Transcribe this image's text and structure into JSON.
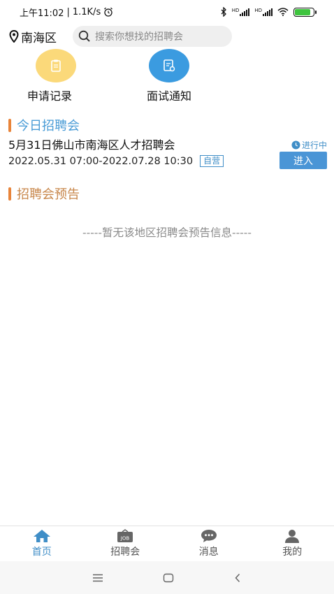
{
  "status_bar": {
    "time": "上午11:02",
    "separator": "|",
    "speed": "1.1K/s",
    "alarm_icon": "alarm-clock-icon",
    "bluetooth_icon": "bluetooth-icon",
    "signal_1_label": "HD",
    "signal_2_label": "HD",
    "wifi_icon": "wifi-icon",
    "battery_level": 0.85,
    "battery_color": "#3ec43e"
  },
  "header": {
    "location": "南海区",
    "location_icon": "map-pin-icon",
    "search_placeholder": "搜索你想找的招聘会",
    "search_icon": "search-icon"
  },
  "quick_actions": [
    {
      "label": "申请记录",
      "icon": "clipboard-icon",
      "color": "#fbd97a"
    },
    {
      "label": "面试通知",
      "icon": "notice-icon",
      "color": "#3b9be0"
    }
  ],
  "today": {
    "title": "今日招聘会",
    "accent": "#e8843a",
    "title_color": "#4a9cd6",
    "fair": {
      "name": "5月31日佛山市南海区人才招聘会",
      "time": "2022.05.31 07:00-2022.07.28 10:30",
      "tag": "自营",
      "status": "进行中",
      "enter_label": "进入"
    }
  },
  "preview": {
    "title": "招聘会预告",
    "title_color": "#c8874b",
    "empty_text": "-----暂无该地区招聘会预告信息-----"
  },
  "tabbar": {
    "items": [
      {
        "label": "首页",
        "icon": "home-icon",
        "active": true
      },
      {
        "label": "招聘会",
        "icon": "job-board-icon",
        "active": false
      },
      {
        "label": "消息",
        "icon": "chat-bubble-icon",
        "active": false
      },
      {
        "label": "我的",
        "icon": "user-icon",
        "active": false
      }
    ],
    "active_color": "#3f8ec7"
  },
  "system_nav": {
    "menu_icon": "menu-icon",
    "home_icon": "square-home-icon",
    "back_icon": "back-chevron-icon"
  }
}
